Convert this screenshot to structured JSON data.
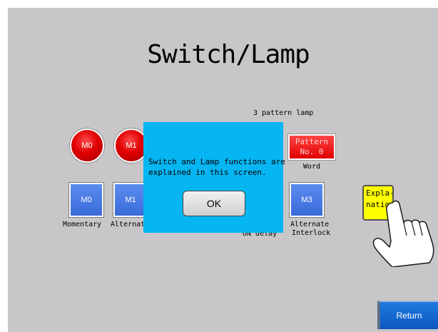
{
  "title": "Switch/Lamp",
  "pattern_header": "3 pattern lamp",
  "lamps": [
    {
      "label": "M0"
    },
    {
      "label": "M1"
    }
  ],
  "pattern_lamp": {
    "line1": "Pattern",
    "line2": "No. 0",
    "caption": "Word"
  },
  "switches": [
    {
      "label": "M0",
      "caption": "Momentary"
    },
    {
      "label": "M1",
      "caption": "Alternat"
    },
    {
      "label": "M3",
      "caption_line1": "Alternate",
      "caption_line2": "Interlock"
    }
  ],
  "hidden_caption": "ON delay",
  "explain_button": {
    "line1": "Expla-",
    "line2": "natio"
  },
  "return_button": {
    "label": "Return"
  },
  "dialog": {
    "message_line1": "Switch and Lamp functions are",
    "message_line2": "explained in this screen.",
    "ok_label": "OK"
  },
  "colors": {
    "background": "#c8c6c8",
    "dialog": "#05b6f2",
    "lamp_red": "#e00000",
    "switch_blue": "#3a6ad8",
    "explain_yellow": "#ffff00",
    "return_blue": "#0a58c0"
  },
  "icons": {
    "pointer": "pointing-hand-icon"
  }
}
